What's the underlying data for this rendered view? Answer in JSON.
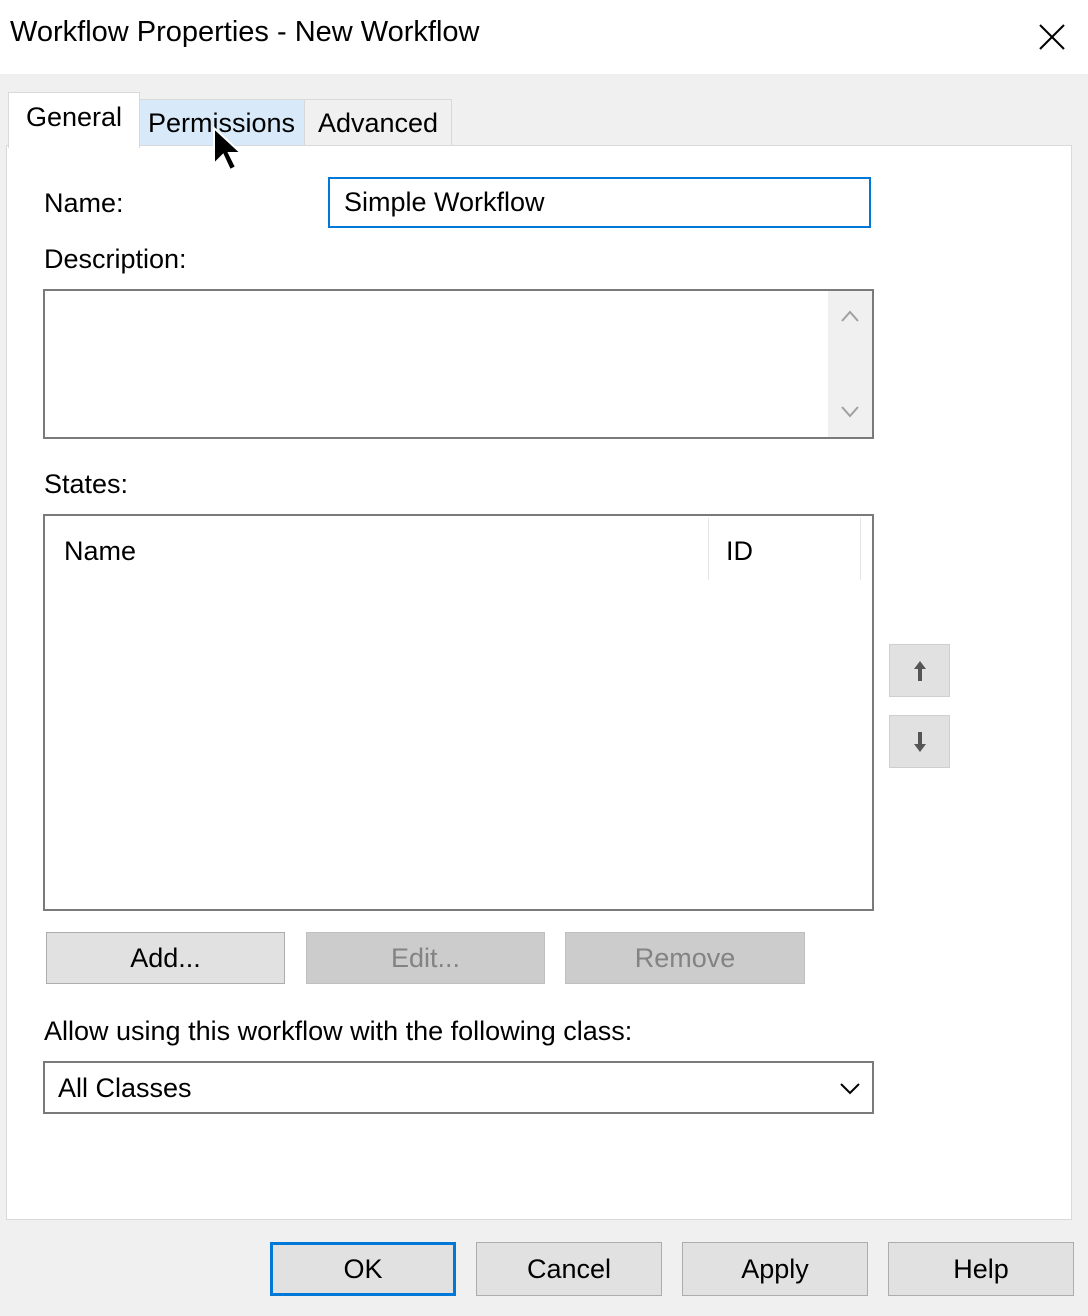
{
  "window": {
    "title": "Workflow Properties - New Workflow"
  },
  "tabs": [
    {
      "label": "General",
      "active": true
    },
    {
      "label": "Permissions",
      "hovered": true
    },
    {
      "label": "Advanced"
    }
  ],
  "general": {
    "name_label": "Name:",
    "name_value": "Simple Workflow",
    "description_label": "Description:",
    "description_value": "",
    "states_label": "States:",
    "states_columns": [
      "Name",
      "ID"
    ],
    "states_rows": [],
    "buttons": {
      "add": "Add...",
      "edit": "Edit...",
      "remove": "Remove"
    },
    "class_label": "Allow using this workflow with the following class:",
    "class_selected": "All Classes"
  },
  "footer": {
    "ok": "OK",
    "cancel": "Cancel",
    "apply": "Apply",
    "help": "Help"
  },
  "icons": {
    "close": "close-icon",
    "move_up": "arrow-up-icon",
    "move_down": "arrow-down-icon",
    "dropdown": "chevron-down-icon",
    "cursor": "mouse-pointer-icon"
  },
  "colors": {
    "focus_border": "#0078d7",
    "tab_hover": "#d8eaf9",
    "panel_bg": "#ffffff",
    "window_bg": "#f0f0f0"
  }
}
